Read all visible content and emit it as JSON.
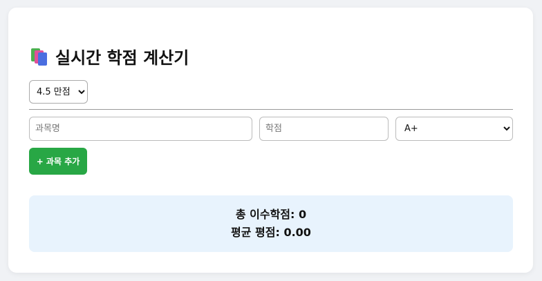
{
  "header": {
    "icon": "books-icon",
    "title": "실시간 학점 계산기"
  },
  "scale": {
    "selected": "4.5 만점",
    "options": [
      "4.5 만점"
    ]
  },
  "form": {
    "subject_placeholder": "과목명",
    "credit_placeholder": "학점",
    "grade_selected": "A+",
    "add_label": "+ 과목 추가"
  },
  "summary": {
    "total_credits": "총 이수학점: 0",
    "gpa": "평균 평점: 0.00"
  },
  "colors": {
    "accent_green": "#28a745",
    "summary_bg": "#e8f3fd"
  }
}
